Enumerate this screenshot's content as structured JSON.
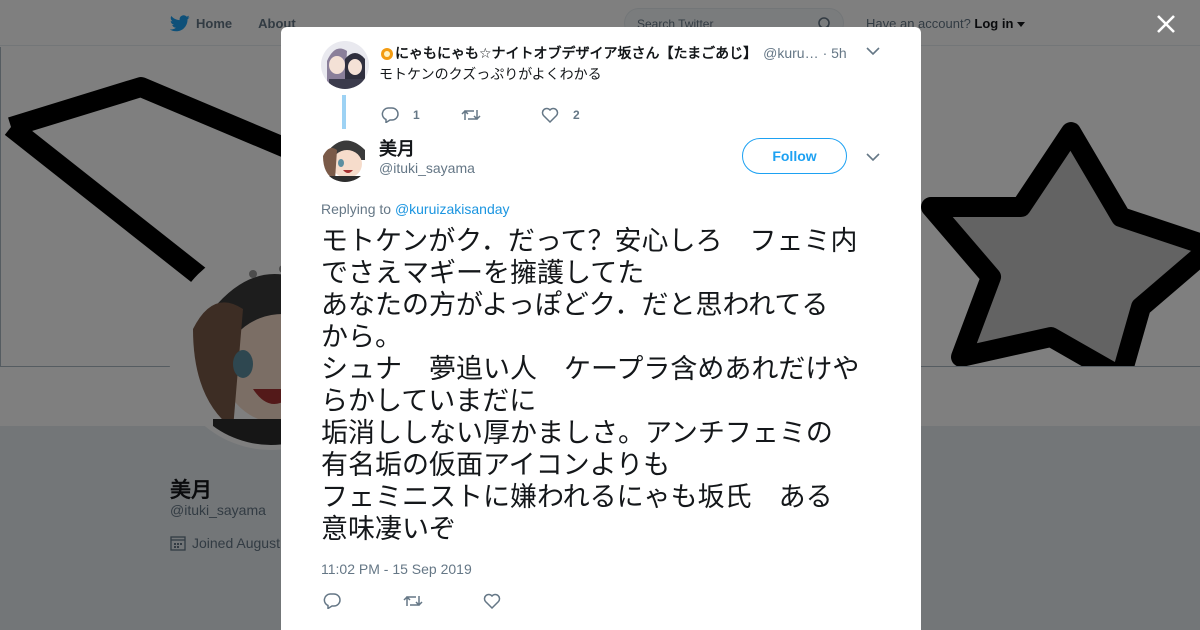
{
  "topbar": {
    "home_label": "Home",
    "about_label": "About",
    "search_placeholder": "Search Twitter",
    "account_text": "Have an account?",
    "login_label": "Log in"
  },
  "profile": {
    "name": "美月",
    "handle": "@ituki_sayama",
    "joined_text": "Joined August"
  },
  "parent_tweet": {
    "display_name": "にゃもにゃも☆ナイトオブデザイア坂さん【たまごあじ】",
    "handle": "@kuru…",
    "time": "· 5h",
    "text": "モトケンのクズっぷりがよくわかる",
    "reply_count": "1",
    "retweet_count": "",
    "like_count": "2"
  },
  "tweet": {
    "display_name": "美月",
    "handle": "@ituki_sayama",
    "follow_label": "Follow",
    "replying_prefix": "Replying to",
    "replying_to": "@kuruizakisanday",
    "lines": [
      "モトケンがク．だって？安心しろ　フェミ内",
      "でさえマギーを擁護してた",
      "あなたの方がよっぽどク．だと思われてる",
      "から。",
      "シュナ　夢追い人　ケープラ含めあれだけや",
      "らかしていまだに",
      "垢消ししない厚かましさ。アンチフェミの",
      "有名垢の仮面アイコンよりも",
      "フェミニストに嫌われるにゃも坂氏　ある",
      "意味凄いぞ"
    ],
    "timestamp": "11:02 PM - 15 Sep 2019"
  },
  "colors": {
    "brand": "#1da1f2",
    "thread_line": "#9dd2f4",
    "muted": "#657786"
  }
}
